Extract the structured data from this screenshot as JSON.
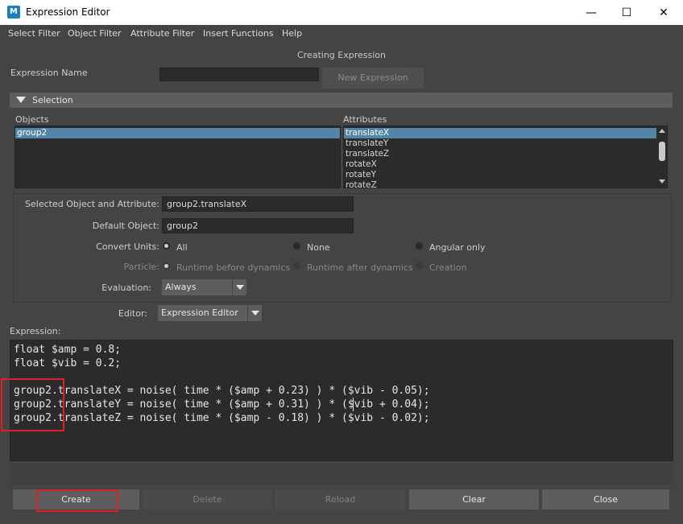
{
  "window": {
    "title": "Expression Editor",
    "app_icon_letter": "M",
    "controls": {
      "minimize": "—",
      "maximize": "☐",
      "close": "✕"
    }
  },
  "menubar": [
    "Select Filter",
    "Object Filter",
    "Attribute Filter",
    "Insert Functions",
    "Help"
  ],
  "status_title": "Creating Expression",
  "expression_name": {
    "label": "Expression Name",
    "value": "",
    "new_button": "New Expression"
  },
  "selection": {
    "header": "Selection",
    "objects_label": "Objects",
    "attributes_label": "Attributes",
    "objects": [
      "group2"
    ],
    "selected_object": "group2",
    "attributes": [
      "translateX",
      "translateY",
      "translateZ",
      "rotateX",
      "rotateY",
      "rotateZ"
    ],
    "selected_attribute": "translateX"
  },
  "settings": {
    "selected_object_attr_label": "Selected Object and Attribute:",
    "selected_object_attr_value": "group2.translateX",
    "default_object_label": "Default Object:",
    "default_object_value": "group2",
    "convert_units_label": "Convert Units:",
    "convert_units_options": [
      "All",
      "None",
      "Angular only"
    ],
    "convert_units_selected": "All",
    "particle_label": "Particle:",
    "particle_options": [
      "Runtime before dynamics",
      "Runtime after dynamics",
      "Creation"
    ],
    "evaluation_label": "Evaluation:",
    "evaluation_value": "Always",
    "editor_label": "Editor:",
    "editor_value": "Expression Editor"
  },
  "expression": {
    "label": "Expression:",
    "lines": [
      "float $amp = 0.8;",
      "float $vib = 0.2;",
      "",
      "group2.translateX = noise( time * ($amp + 0.23) ) * ($vib - 0.05);",
      "group2.translateY = noise( time * ($amp + 0.31) ) * ($vib + 0.04);",
      "group2.translateZ = noise( time * ($amp - 0.18) ) * ($vib - 0.02);"
    ]
  },
  "buttons": {
    "create": "Create",
    "delete": "Delete",
    "reload": "Reload",
    "clear": "Clear",
    "close": "Close"
  },
  "colors": {
    "background": "#444444",
    "field": "#2b2b2b",
    "selection": "#5285a6",
    "highlight": "#e01f26"
  }
}
